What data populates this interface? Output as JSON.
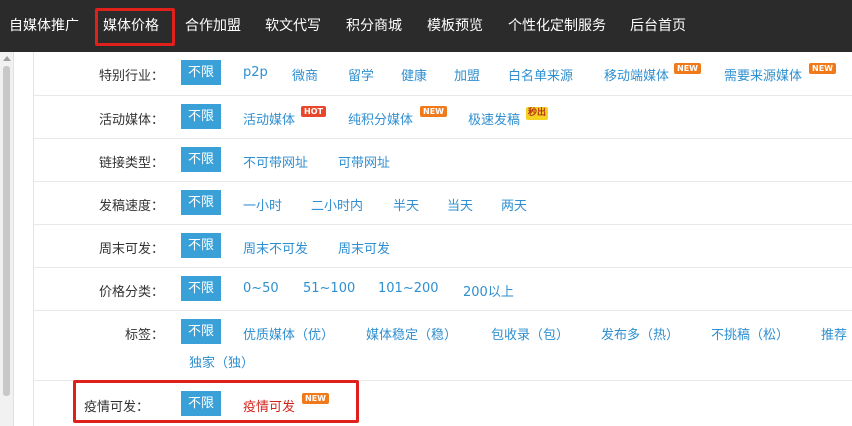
{
  "nav": {
    "items": [
      {
        "label": "自媒体推广"
      },
      {
        "label": "媒体价格"
      },
      {
        "label": "合作加盟"
      },
      {
        "label": "软文代写"
      },
      {
        "label": "积分商城"
      },
      {
        "label": "模板预览"
      },
      {
        "label": "个性化定制服务"
      },
      {
        "label": "后台首页"
      }
    ],
    "active_index": 1,
    "highlight_color": "#e0201b"
  },
  "filters": {
    "all_label": "不限",
    "industry": {
      "label": "特别行业：",
      "options": [
        "p2p",
        "微商",
        "留学",
        "健康",
        "加盟",
        "白名单来源",
        "移动端媒体",
        "需要来源媒体"
      ],
      "badges": {
        "mobile": "NEW",
        "source": "NEW"
      }
    },
    "activity": {
      "label": "活动媒体：",
      "options": [
        "活动媒体",
        "纯积分媒体",
        "极速发稿"
      ],
      "badges": {
        "activity": "HOT",
        "points": "NEW",
        "fast": "秒出"
      }
    },
    "link": {
      "label": "链接类型：",
      "options": [
        "不可带网址",
        "可带网址"
      ]
    },
    "speed": {
      "label": "发稿速度：",
      "options": [
        "一小时",
        "二小时内",
        "半天",
        "当天",
        "两天"
      ]
    },
    "weekend": {
      "label": "周末可发：",
      "options": [
        "周末不可发",
        "周末可发"
      ]
    },
    "price": {
      "label": "价格分类：",
      "options": [
        "0~50",
        "51~100",
        "101~200",
        "200以上"
      ]
    },
    "tags": {
      "label": "标签：",
      "options": [
        "优质媒体（优）",
        "媒体稳定（稳）",
        "包收录（包）",
        "发布多（热）",
        "不挑稿（松）",
        "推荐",
        "独家（独）"
      ]
    },
    "epidemic": {
      "label": "疫情可发：",
      "options": [
        "疫情可发"
      ],
      "badges": {
        "epidemic": "NEW"
      }
    }
  },
  "colors": {
    "nav_bg": "#2b2b2b",
    "chip_bg": "#3aa0d8",
    "link": "#2f8fd0",
    "alert_red": "#d3261d"
  }
}
